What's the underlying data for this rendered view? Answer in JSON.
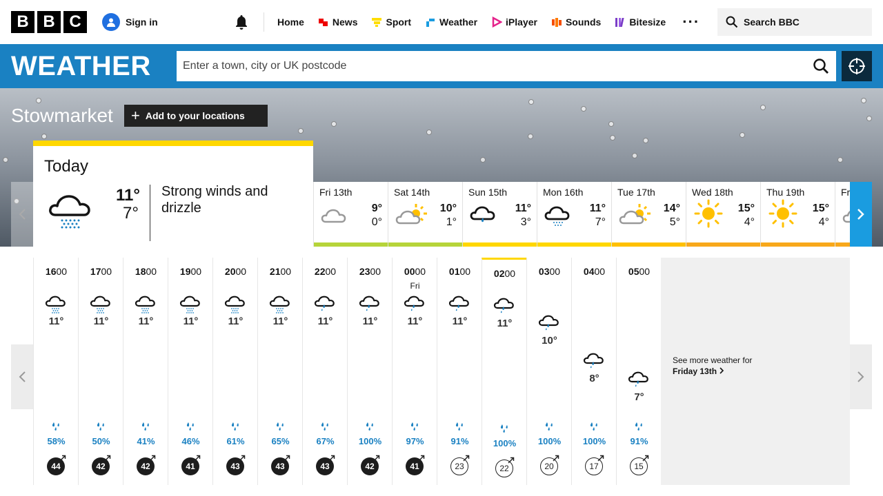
{
  "header": {
    "logo": [
      "B",
      "B",
      "C"
    ],
    "sign_in": "Sign in",
    "nav": [
      {
        "label": "Home",
        "icon": "home"
      },
      {
        "label": "News",
        "icon": "news-icon",
        "color": "#e00"
      },
      {
        "label": "Sport",
        "icon": "sport-icon",
        "color": "#fd0"
      },
      {
        "label": "Weather",
        "icon": "weather-icon",
        "color": "#1a9ce0"
      },
      {
        "label": "iPlayer",
        "icon": "iplayer-icon",
        "color": "#e5238b"
      },
      {
        "label": "Sounds",
        "icon": "sounds-icon",
        "color": "#f54e00"
      },
      {
        "label": "Bitesize",
        "icon": "bitesize-icon",
        "color": "#7b3ec7"
      }
    ],
    "more": "···",
    "search_label": "Search BBC"
  },
  "weather_bar": {
    "title": "WEATHER",
    "search_placeholder": "Enter a town, city or UK postcode"
  },
  "location": {
    "city": "Stowmarket",
    "add_label": "Add to your locations"
  },
  "today": {
    "label": "Today",
    "high": "11°",
    "low": "7°",
    "description": "Strong winds and drizzle",
    "icon": "drizzle-cloud-icon"
  },
  "forecast_days": [
    {
      "day": "Fri",
      "date": "13th",
      "high": "9°",
      "low": "0°",
      "icon": "cloud-icon",
      "bar": "#b6d43a"
    },
    {
      "day": "Sat",
      "date": "14th",
      "high": "10°",
      "low": "1°",
      "icon": "sun-cloud-icon",
      "bar": "#b6d43a"
    },
    {
      "day": "Sun",
      "date": "15th",
      "high": "11°",
      "low": "3°",
      "icon": "rain-cloud-icon",
      "bar": "#ffd700"
    },
    {
      "day": "Mon",
      "date": "16th",
      "high": "11°",
      "low": "7°",
      "icon": "drizzle-cloud-icon",
      "bar": "#ffd700"
    },
    {
      "day": "Tue",
      "date": "17th",
      "high": "14°",
      "low": "5°",
      "icon": "sun-cloud-icon",
      "bar": "#ffc000"
    },
    {
      "day": "Wed",
      "date": "18th",
      "high": "15°",
      "low": "4°",
      "icon": "sun-icon",
      "bar": "#f8a81b"
    },
    {
      "day": "Thu",
      "date": "19th",
      "high": "15°",
      "low": "4°",
      "icon": "sun-icon",
      "bar": "#f8a81b"
    },
    {
      "day": "Fr",
      "date": "",
      "high": "",
      "low": "",
      "icon": "cloud-icon",
      "bar": "#f8a81b"
    }
  ],
  "hourly": [
    {
      "h": "16",
      "m": "00",
      "day": "",
      "temp": "11°",
      "icon": "drizzle",
      "pct": "58%",
      "wind": "44",
      "dark": true
    },
    {
      "h": "17",
      "m": "00",
      "day": "",
      "temp": "11°",
      "icon": "drizzle",
      "pct": "50%",
      "wind": "42",
      "dark": true
    },
    {
      "h": "18",
      "m": "00",
      "day": "",
      "temp": "11°",
      "icon": "drizzle",
      "pct": "41%",
      "wind": "42",
      "dark": true
    },
    {
      "h": "19",
      "m": "00",
      "day": "",
      "temp": "11°",
      "icon": "drizzle",
      "pct": "46%",
      "wind": "41",
      "dark": true
    },
    {
      "h": "20",
      "m": "00",
      "day": "",
      "temp": "11°",
      "icon": "drizzle",
      "pct": "61%",
      "wind": "43",
      "dark": true
    },
    {
      "h": "21",
      "m": "00",
      "day": "",
      "temp": "11°",
      "icon": "drizzle",
      "pct": "65%",
      "wind": "43",
      "dark": true
    },
    {
      "h": "22",
      "m": "00",
      "day": "",
      "temp": "11°",
      "icon": "rain",
      "pct": "67%",
      "wind": "43",
      "dark": true
    },
    {
      "h": "23",
      "m": "00",
      "day": "",
      "temp": "11°",
      "icon": "rain",
      "pct": "100%",
      "wind": "42",
      "dark": true
    },
    {
      "h": "00",
      "m": "00",
      "day": "Fri",
      "temp": "11°",
      "icon": "rain",
      "pct": "97%",
      "wind": "41",
      "dark": true
    },
    {
      "h": "01",
      "m": "00",
      "day": "",
      "temp": "11°",
      "icon": "rain",
      "pct": "91%",
      "wind": "23",
      "dark": false
    },
    {
      "h": "02",
      "m": "00",
      "day": "",
      "temp": "11°",
      "icon": "rain",
      "pct": "100%",
      "wind": "22",
      "dark": false
    },
    {
      "h": "03",
      "m": "00",
      "day": "",
      "temp": "10°",
      "icon": "rain",
      "pct": "100%",
      "wind": "20",
      "dark": false
    },
    {
      "h": "04",
      "m": "00",
      "day": "",
      "temp": "8°",
      "icon": "rain",
      "pct": "100%",
      "wind": "17",
      "dark": false
    },
    {
      "h": "05",
      "m": "00",
      "day": "",
      "temp": "7°",
      "icon": "rain",
      "pct": "91%",
      "wind": "15",
      "dark": false
    }
  ],
  "see_more": {
    "line1": "See more weather for",
    "line2": "Friday 13th"
  },
  "colors": {
    "weather_blue": "#1a81c2",
    "accent_yellow": "#ffd700",
    "rain_blue": "#1a81c2"
  }
}
